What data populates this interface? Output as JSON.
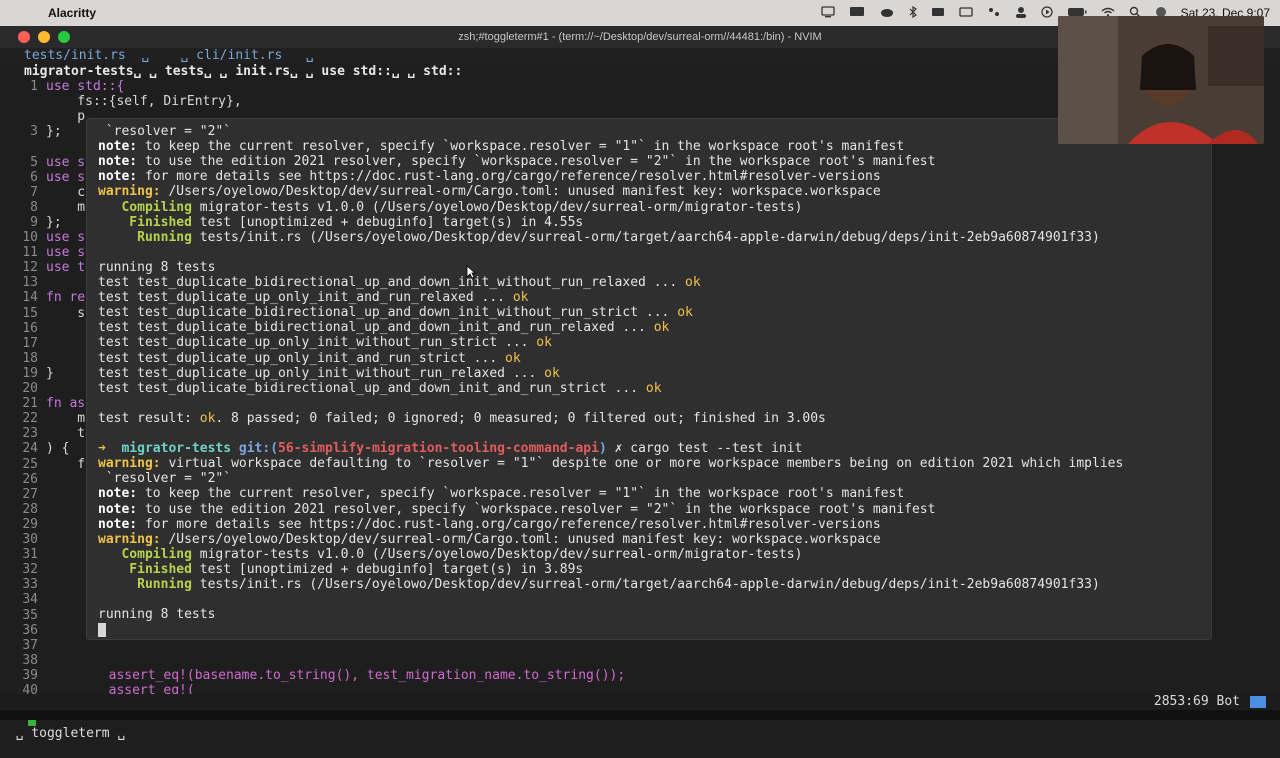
{
  "menubar": {
    "apple_glyph": "",
    "app_name": "Alacritty",
    "clock": "Sat 23. Dec 9:07"
  },
  "window": {
    "title": "zsh;#toggleterm#1 - (term://~/Desktop/dev/surreal-orm//44481:/bin) - NVIM"
  },
  "tabline": {
    "text": "tests/init.rs  ␣    ␣ cli/init.rs   ␣"
  },
  "winbar": {
    "text": "migrator-tests␣ ␣ tests␣ ␣ init.rs␣ ␣ use std::␣ ␣ std::"
  },
  "code_lines": [
    {
      "n": "1",
      "text": "use std::{"
    },
    {
      "n": "",
      "text": "    fs::{self, DirEntry},"
    },
    {
      "n": "",
      "text": "    p"
    },
    {
      "n": "3",
      "text": "};"
    },
    {
      "n": "",
      "text": ""
    },
    {
      "n": "5",
      "text": "use s"
    },
    {
      "n": "6",
      "text": "use s"
    },
    {
      "n": "7",
      "text": "    c"
    },
    {
      "n": "8",
      "text": "    m"
    },
    {
      "n": "9",
      "text": "};"
    },
    {
      "n": "10",
      "text": "use s"
    },
    {
      "n": "11",
      "text": "use s"
    },
    {
      "n": "12",
      "text": "use t"
    },
    {
      "n": "13",
      "text": ""
    },
    {
      "n": "14",
      "text": "fn re"
    },
    {
      "n": "15",
      "text": "    s"
    },
    {
      "n": "16",
      "text": ""
    },
    {
      "n": "17",
      "text": ""
    },
    {
      "n": "18",
      "text": ""
    },
    {
      "n": "19",
      "text": "}"
    },
    {
      "n": "20",
      "text": ""
    },
    {
      "n": "21",
      "text": "fn as"
    },
    {
      "n": "22",
      "text": "    m"
    },
    {
      "n": "23",
      "text": "    t"
    },
    {
      "n": "24",
      "text": ") {"
    },
    {
      "n": "25",
      "text": "    f"
    },
    {
      "n": "26",
      "text": ""
    },
    {
      "n": "27",
      "text": ""
    },
    {
      "n": "28",
      "text": ""
    },
    {
      "n": "29",
      "text": ""
    },
    {
      "n": "30",
      "text": ""
    },
    {
      "n": "31",
      "text": ""
    },
    {
      "n": "32",
      "text": ""
    },
    {
      "n": "33",
      "text": ""
    },
    {
      "n": "34",
      "text": ""
    },
    {
      "n": "35",
      "text": ""
    },
    {
      "n": "36",
      "text": ""
    },
    {
      "n": "37",
      "text": ""
    },
    {
      "n": "38",
      "text": ""
    },
    {
      "n": "39",
      "text": "        assert_eq!(basename.to_string(), test_migration_name.to_string());"
    },
    {
      "n": "40",
      "text": "        assert_eq!("
    }
  ],
  "terminal": {
    "lines": [
      {
        "label": "",
        "text": " `resolver = \"2\"`"
      },
      {
        "label": "note:",
        "text": " to keep the current resolver, specify `workspace.resolver = \"1\"` in the workspace root's manifest"
      },
      {
        "label": "note:",
        "text": " to use the edition 2021 resolver, specify `workspace.resolver = \"2\"` in the workspace root's manifest"
      },
      {
        "label": "note:",
        "text": " for more details see https://doc.rust-lang.org/cargo/reference/resolver.html#resolver-versions"
      },
      {
        "label": "warning:",
        "text": " /Users/oyelowo/Desktop/dev/surreal-orm/Cargo.toml: unused manifest key: workspace.workspace"
      },
      {
        "label": "   Compiling",
        "text": " migrator-tests v1.0.0 (/Users/oyelowo/Desktop/dev/surreal-orm/migrator-tests)"
      },
      {
        "label": "    Finished",
        "text": " test [unoptimized + debuginfo] target(s) in 4.55s"
      },
      {
        "label": "     Running",
        "text": " tests/init.rs (/Users/oyelowo/Desktop/dev/surreal-orm/target/aarch64-apple-darwin/debug/deps/init-2eb9a60874901f33)"
      },
      {
        "label": "",
        "text": ""
      },
      {
        "label": "",
        "text": "running 8 tests"
      },
      {
        "label": "",
        "text": "test test_duplicate_bidirectional_up_and_down_init_without_run_relaxed ... ",
        "ok": "ok"
      },
      {
        "label": "",
        "text": "test test_duplicate_up_only_init_and_run_relaxed ... ",
        "ok": "ok"
      },
      {
        "label": "",
        "text": "test test_duplicate_bidirectional_up_and_down_init_without_run_strict ... ",
        "ok": "ok"
      },
      {
        "label": "",
        "text": "test test_duplicate_bidirectional_up_and_down_init_and_run_relaxed ... ",
        "ok": "ok"
      },
      {
        "label": "",
        "text": "test test_duplicate_up_only_init_without_run_strict ... ",
        "ok": "ok"
      },
      {
        "label": "",
        "text": "test test_duplicate_up_only_init_and_run_strict ... ",
        "ok": "ok"
      },
      {
        "label": "",
        "text": "test test_duplicate_up_only_init_without_run_relaxed ... ",
        "ok": "ok"
      },
      {
        "label": "",
        "text": "test test_duplicate_bidirectional_up_and_down_init_and_run_strict ... ",
        "ok": "ok"
      },
      {
        "label": "",
        "text": ""
      },
      {
        "label": "",
        "text": "test result: ",
        "ok": "ok",
        "after": ". 8 passed; 0 failed; 0 ignored; 0 measured; 0 filtered out; finished in 3.00s"
      },
      {
        "label": "",
        "text": ""
      },
      {
        "prompt": true,
        "arrow": "➜",
        "dir": "  migrator-tests",
        "git": " git:(",
        "branch": "56-simplify-migration-tooling-command-api",
        "git_close": ")",
        "cmd": " ✗ cargo test --test init"
      },
      {
        "label": "warning:",
        "text": " virtual workspace defaulting to `resolver = \"1\"` despite one or more workspace members being on edition 2021 which implies"
      },
      {
        "label": "",
        "text": " `resolver = \"2\"`"
      },
      {
        "label": "note:",
        "text": " to keep the current resolver, specify `workspace.resolver = \"1\"` in the workspace root's manifest"
      },
      {
        "label": "note:",
        "text": " to use the edition 2021 resolver, specify `workspace.resolver = \"2\"` in the workspace root's manifest"
      },
      {
        "label": "note:",
        "text": " for more details see https://doc.rust-lang.org/cargo/reference/resolver.html#resolver-versions"
      },
      {
        "label": "warning:",
        "text": " /Users/oyelowo/Desktop/dev/surreal-orm/Cargo.toml: unused manifest key: workspace.workspace"
      },
      {
        "label": "   Compiling",
        "text": " migrator-tests v1.0.0 (/Users/oyelowo/Desktop/dev/surreal-orm/migrator-tests)"
      },
      {
        "label": "    Finished",
        "text": " test [unoptimized + debuginfo] target(s) in 3.89s"
      },
      {
        "label": "     Running",
        "text": " tests/init.rs (/Users/oyelowo/Desktop/dev/surreal-orm/target/aarch64-apple-darwin/debug/deps/init-2eb9a60874901f33)"
      },
      {
        "label": "",
        "text": ""
      },
      {
        "label": "",
        "text": "running 8 tests"
      }
    ]
  },
  "statusbar": {
    "left": "␣ toggleterm ␣",
    "position": "2853:69 Bot"
  },
  "colors": {
    "accent_ok": "#f0c24b",
    "mode_green": "#3ab13a",
    "position_block": "#4a90e2"
  }
}
